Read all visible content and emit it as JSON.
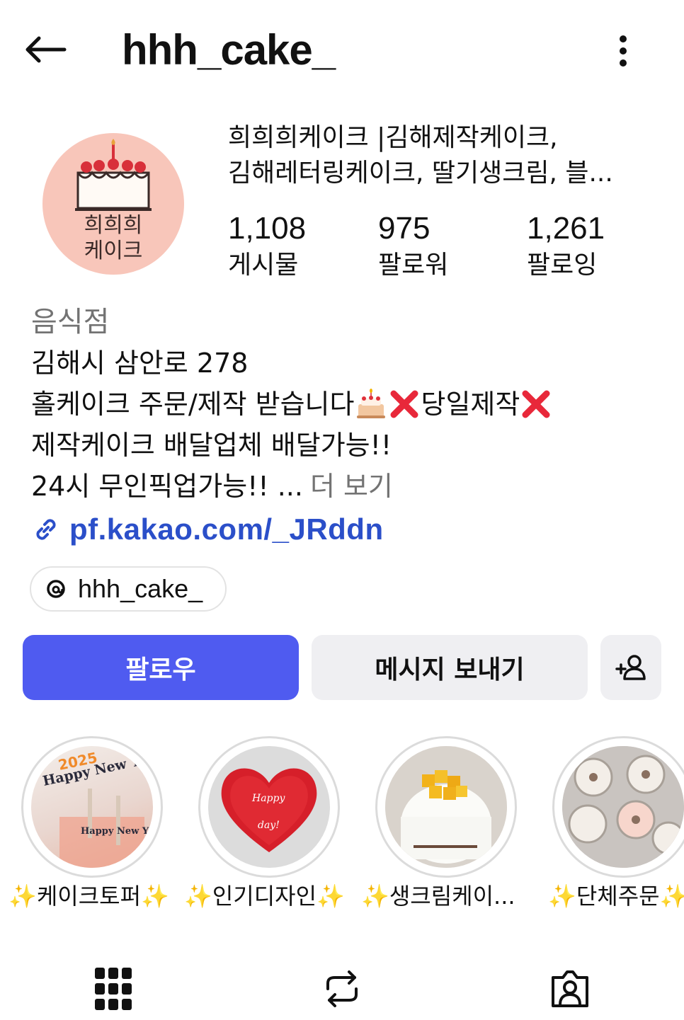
{
  "header": {
    "username": "hhh_cake_",
    "back_icon": "arrow-left-icon",
    "more_icon": "vertical-dots-icon"
  },
  "profile": {
    "avatar_text_line1": "희희희",
    "avatar_text_line2": "케이크",
    "name_line1": "희희희케이크 |김해제작케이크,",
    "name_line2": "김해레터링케이크, 딸기생크림, 블...",
    "stats": [
      {
        "value": "1,108",
        "label": "게시물"
      },
      {
        "value": "975",
        "label": "팔로워"
      },
      {
        "value": "1,261",
        "label": "팔로잉"
      }
    ]
  },
  "bio": {
    "category": "음식점",
    "line1": "김해시 삼안로 278",
    "line2_a": "홀케이크 주문/제작 받습니다",
    "line2_b": "당일제작",
    "line3": "제작케이크 배달업체 배달가능!!",
    "line4": "24시 무인픽업가능!! ...",
    "more_label": "더 보기",
    "link": "pf.kakao.com/_JRddn",
    "threads_handle": "hhh_cake_"
  },
  "actions": {
    "follow_label": "팔로우",
    "message_label": "메시지 보내기",
    "add_icon": "add-person-icon"
  },
  "highlights": [
    {
      "label": "✨케이크토퍼✨"
    },
    {
      "label": "✨인기디자인✨"
    },
    {
      "label": "✨생크림케이..."
    },
    {
      "label": "✨단체주문✨"
    }
  ],
  "highlight_images": {
    "h1_text": "Happy New Year",
    "h1_year": "2025",
    "h2_text_1": "Happy",
    "h2_text_2": "day!"
  },
  "tabs": [
    {
      "icon": "grid-icon"
    },
    {
      "icon": "reels-repost-icon"
    },
    {
      "icon": "tagged-person-icon"
    }
  ],
  "colors": {
    "follow_bg": "#4f5bf0",
    "link": "#2b4fc9",
    "muted": "#737373"
  }
}
